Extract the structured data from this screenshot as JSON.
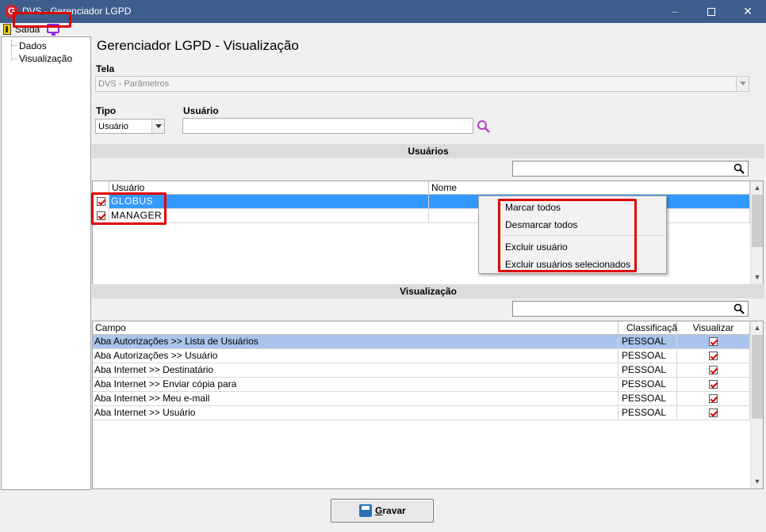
{
  "window": {
    "logo_letter": "G",
    "title": "DVS - Gerenciador LGPD"
  },
  "toolbar": {
    "exit_label": "Saída"
  },
  "tree": {
    "items": [
      {
        "label": "Dados"
      },
      {
        "label": "Visualização"
      }
    ]
  },
  "main": {
    "title": "Gerenciador LGPD - Visualização",
    "tela_label": "Tela",
    "tela_value": "DVS - Parâmetros",
    "tipo_label": "Tipo",
    "tipo_value": "Usuário",
    "usuario_label": "Usuário",
    "usuario_value": ""
  },
  "users_section": {
    "title": "Usuários",
    "filter_value": "",
    "columns": [
      "Usuário",
      "Nome"
    ],
    "rows": [
      {
        "usuario": "GLOBUS",
        "nome": "",
        "checked": true
      },
      {
        "usuario": "MANAGER",
        "nome": "",
        "checked": true
      }
    ]
  },
  "context_menu": {
    "items": [
      "Marcar todos",
      "Desmarcar todos",
      "Excluir usuário",
      "Excluir usuários selecionados"
    ]
  },
  "vis_section": {
    "title": "Visualização",
    "filter_value": "",
    "columns": [
      "Campo",
      "Classificação",
      "Visualizar"
    ],
    "rows": [
      {
        "campo": "Aba Autorizações >> Lista de Usuários",
        "classificacao": "PESSOAL",
        "visualizar": true
      },
      {
        "campo": "Aba Autorizações >> Usuário",
        "classificacao": "PESSOAL",
        "visualizar": true
      },
      {
        "campo": "Aba Internet >> Destinatário",
        "classificacao": "PESSOAL",
        "visualizar": true
      },
      {
        "campo": "Aba Internet >> Enviar cópia para",
        "classificacao": "PESSOAL",
        "visualizar": true
      },
      {
        "campo": "Aba Internet >> Meu e-mail",
        "classificacao": "PESSOAL",
        "visualizar": true
      },
      {
        "campo": "Aba Internet >> Usuário",
        "classificacao": "PESSOAL",
        "visualizar": true
      }
    ]
  },
  "footer": {
    "save_label_first": "G",
    "save_label_rest": "ravar"
  },
  "colors": {
    "titlebar": "#3e5f8e",
    "selection": "#3399ff",
    "highlight_box": "#e00000"
  }
}
